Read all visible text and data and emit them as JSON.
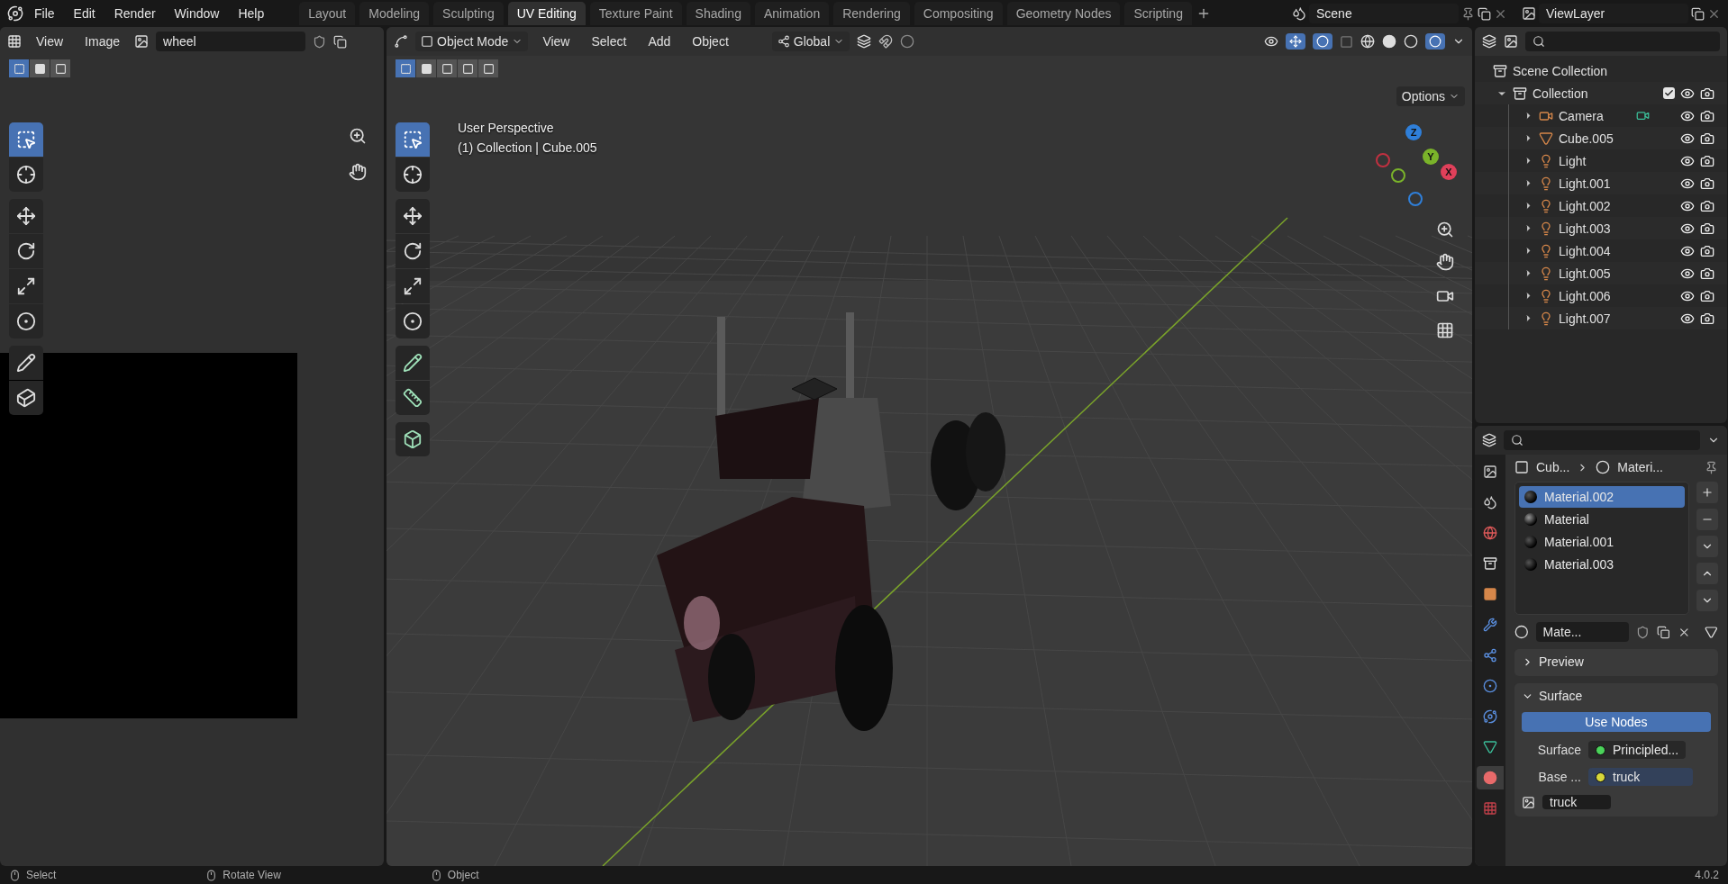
{
  "menu": [
    "File",
    "Edit",
    "Render",
    "Window",
    "Help"
  ],
  "workspaces": [
    {
      "label": "Layout",
      "selected": false
    },
    {
      "label": "Modeling",
      "selected": false
    },
    {
      "label": "Sculpting",
      "selected": false
    },
    {
      "label": "UV Editing",
      "selected": true
    },
    {
      "label": "Texture Paint",
      "selected": false
    },
    {
      "label": "Shading",
      "selected": false
    },
    {
      "label": "Animation",
      "selected": false
    },
    {
      "label": "Rendering",
      "selected": false
    },
    {
      "label": "Compositing",
      "selected": false
    },
    {
      "label": "Geometry Nodes",
      "selected": false
    },
    {
      "label": "Scripting",
      "selected": false
    }
  ],
  "scene": "Scene",
  "view_layer": "ViewLayer",
  "uv_editor": {
    "menus": [
      "View",
      "Image"
    ],
    "image_name": "wheel"
  },
  "viewport": {
    "mode": "Object Mode",
    "menus": [
      "View",
      "Select",
      "Add",
      "Object"
    ],
    "orientation": "Global",
    "options": "Options",
    "view_name": "User Perspective",
    "context": "(1) Collection | Cube.005",
    "axes": [
      "Z",
      "Y",
      "X"
    ]
  },
  "outliner": {
    "root": "Scene Collection",
    "collection": {
      "label": "Collection",
      "expanded": true,
      "checked": true,
      "children": [
        {
          "label": "Camera",
          "kind": "camera"
        },
        {
          "label": "Cube.005",
          "kind": "mesh"
        },
        {
          "label": "Light",
          "kind": "light"
        },
        {
          "label": "Light.001",
          "kind": "light"
        },
        {
          "label": "Light.002",
          "kind": "light"
        },
        {
          "label": "Light.003",
          "kind": "light"
        },
        {
          "label": "Light.004",
          "kind": "light"
        },
        {
          "label": "Light.005",
          "kind": "light"
        },
        {
          "label": "Light.006",
          "kind": "light"
        },
        {
          "label": "Light.007",
          "kind": "light"
        }
      ]
    }
  },
  "properties": {
    "breadcrumb": [
      "Cub...",
      "Materi..."
    ],
    "material_slots": [
      {
        "label": "Material.002",
        "selected": true
      },
      {
        "label": "Material",
        "selected": false
      },
      {
        "label": "Material.001",
        "selected": false
      },
      {
        "label": "Material.003",
        "selected": false
      }
    ],
    "material_name": "Mate...",
    "panels": [
      {
        "label": "Preview",
        "expanded": false
      },
      {
        "label": "Surface",
        "expanded": true
      }
    ],
    "use_nodes": "Use Nodes",
    "surface_label": "Surface",
    "surface_value": "Principled...",
    "base_label": "Base ...",
    "base_value": "truck",
    "texture_name": "truck"
  },
  "status_bar": {
    "hints": [
      "Select",
      "Rotate View",
      "Object"
    ],
    "version": "4.0.2"
  }
}
